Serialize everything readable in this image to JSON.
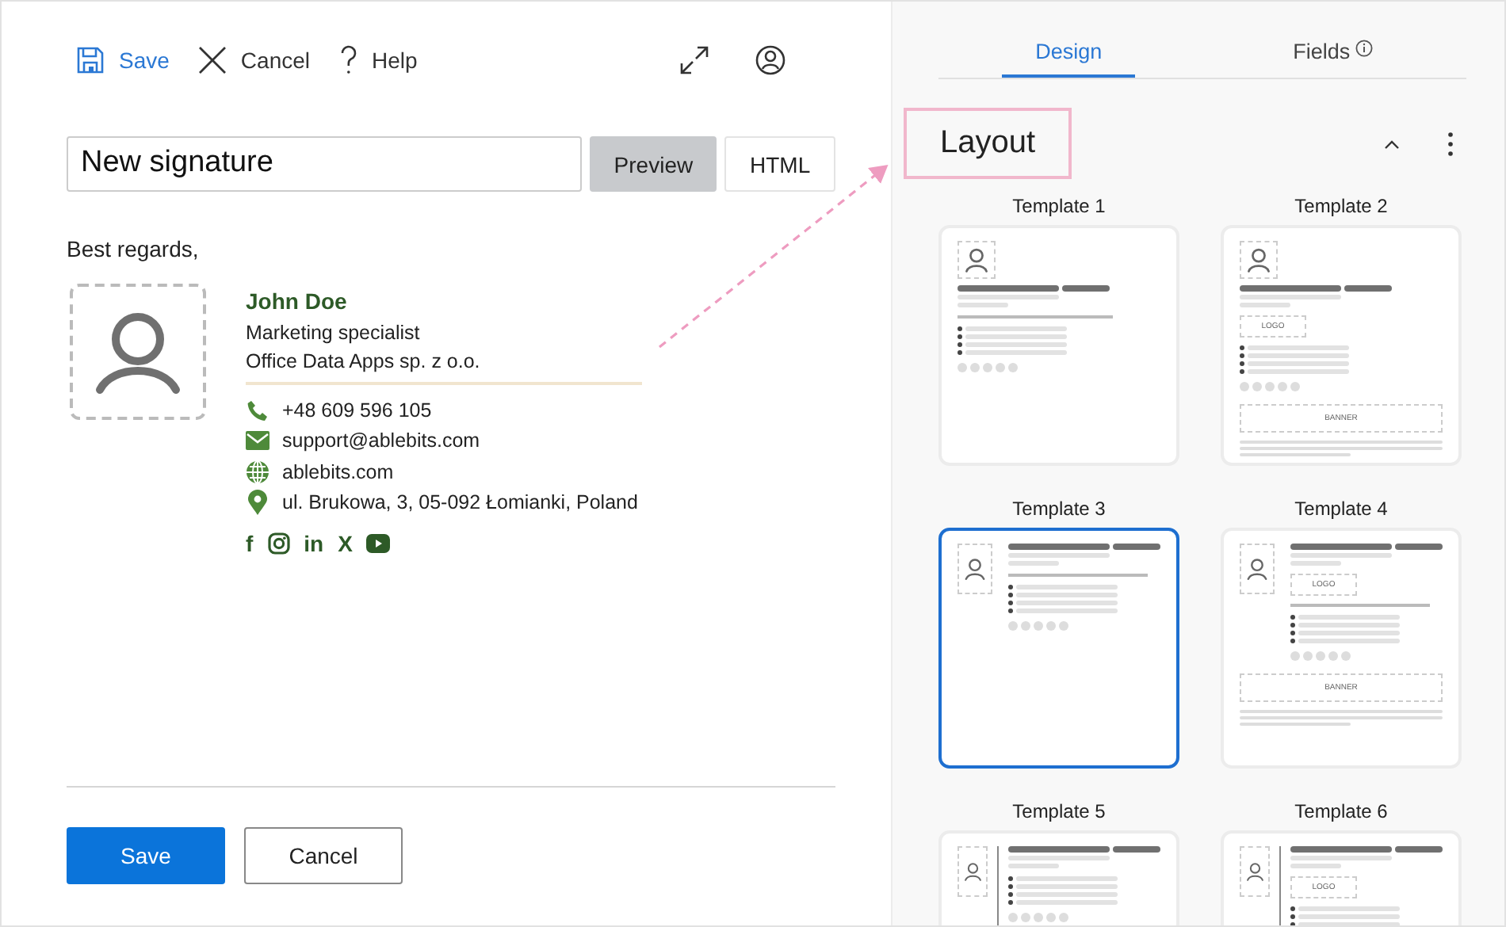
{
  "toolbar": {
    "actions": [
      {
        "kind": "save",
        "label": "Save"
      },
      {
        "kind": "cancel",
        "label": "Cancel"
      },
      {
        "kind": "help",
        "label": "Help"
      }
    ]
  },
  "name_field": {
    "value": "New signature"
  },
  "view_tabs": [
    {
      "label": "Preview",
      "selected": true
    },
    {
      "label": "HTML",
      "selected": false
    }
  ],
  "signature": {
    "greeting": "Best regards,",
    "name": "John Doe",
    "title": "Marketing specialist",
    "company": "Office Data Apps sp. z o.o.",
    "contacts": [
      {
        "kind": "phone",
        "text": "+48 609 596 105"
      },
      {
        "kind": "email",
        "text": "support@ablebits.com"
      },
      {
        "kind": "web",
        "text": "ablebits.com"
      },
      {
        "kind": "address",
        "text": "ul. Brukowa, 3, 05-092 Łomianki, Poland"
      }
    ],
    "social": [
      {
        "kind": "text",
        "label": "f"
      },
      {
        "kind": "instagram"
      },
      {
        "kind": "text",
        "label": "in"
      },
      {
        "kind": "text",
        "label": "X"
      },
      {
        "kind": "youtube"
      }
    ]
  },
  "buttons": [
    {
      "kind": "primary",
      "label": "Save"
    },
    {
      "kind": "secondary",
      "label": "Cancel"
    }
  ],
  "panel": {
    "tabs": [
      {
        "label": "Design",
        "selected": true,
        "info": false
      },
      {
        "label": "Fields",
        "selected": false,
        "info": true
      }
    ],
    "section": {
      "title": "Layout",
      "expanded": true
    },
    "templates": [
      {
        "label": "Template 1",
        "selected": false,
        "kind": "stacked"
      },
      {
        "label": "Template 2",
        "selected": false,
        "kind": "stacked",
        "logo": "LOGO",
        "banner": "BANNER"
      },
      {
        "label": "Template 3",
        "selected": true,
        "kind": "side"
      },
      {
        "label": "Template 4",
        "selected": false,
        "kind": "side",
        "logo": "LOGO",
        "banner": "BANNER"
      },
      {
        "label": "Template 5",
        "selected": false,
        "kind": "divided"
      },
      {
        "label": "Template 6",
        "selected": false,
        "kind": "divided",
        "logo": "LOGO"
      }
    ]
  }
}
